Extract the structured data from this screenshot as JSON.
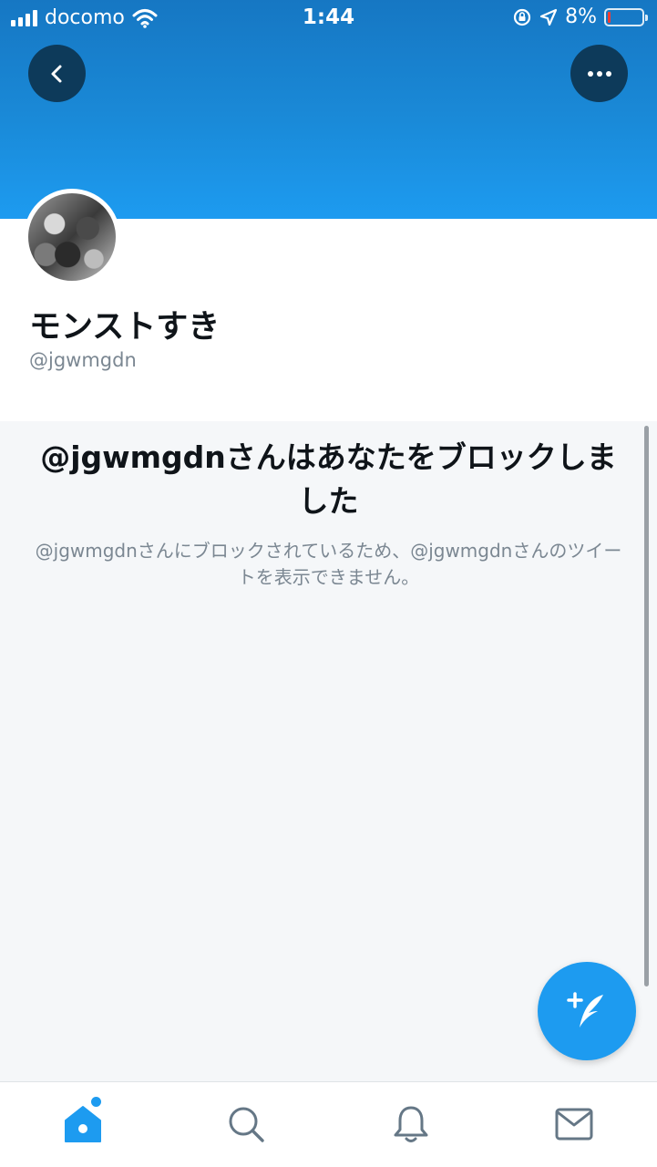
{
  "status_bar": {
    "carrier": "docomo",
    "time": "1:44",
    "battery": "8%"
  },
  "profile": {
    "display_name": "モンストすき",
    "handle": "@jgwmgdn"
  },
  "blocked": {
    "title": "@jgwmgdnさんはあなたをブロックしました",
    "description": "@jgwmgdnさんにブロックされているため、@jgwmgdnさんのツイートを表示できません。"
  },
  "tabs": [
    {
      "icon": "home-icon",
      "active": true
    },
    {
      "icon": "search-icon",
      "active": false
    },
    {
      "icon": "bell-icon",
      "active": false
    },
    {
      "icon": "mail-icon",
      "active": false
    }
  ],
  "colors": {
    "accent": "#1d9bf0",
    "header_top": "#1677c3",
    "text_primary": "#0f1419",
    "text_secondary": "#7b8792",
    "blocked_background": "#f5f7f9"
  }
}
